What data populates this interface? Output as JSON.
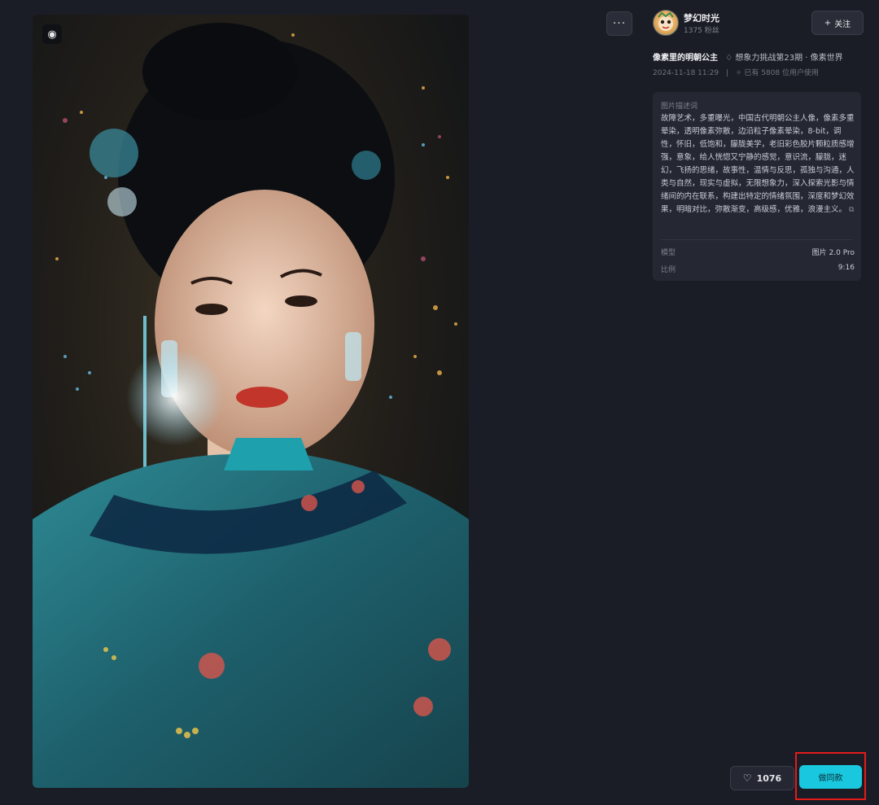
{
  "image": {
    "alt": "",
    "brand_badge_icon": "brain-icon"
  },
  "toolbar": {
    "more_label": "···"
  },
  "author": {
    "name": "梦幻时光",
    "fans": "1375 粉丝",
    "follow_label": "关注",
    "follow_icon": "+"
  },
  "work": {
    "title": "像素里的明朝公主",
    "challenge": "想象力挑战第23期 · 像素世界",
    "challenge_icon": "bulb-icon",
    "date": "2024-11-18 11:29",
    "usage": "已有 5808 位用户使用",
    "usage_icon": "wand-icon"
  },
  "prompt_card": {
    "label": "图片描述词",
    "text": "故障艺术，多重曝光，中国古代明朝公主人像，像素多重晕染，透明像素弥散，边沿粒子像素晕染，8-bit，调性，怀旧，低饱和，朦胧美学，老旧彩色胶片颗粒质感增强，意象，给人恍惚又宁静的感觉，意识流，朦胧，迷幻，飞扬的思绪，故事性，温情与反思，孤独与沟通，人类与自然，现实与虚拟，无限想象力，深入探索光影与情绪间的内在联系，构建出特定的情绪氛围，深度和梦幻效果，明暗对比，弥散渐变，高级感，优雅，浪漫主义。",
    "model_label": "模型",
    "model_value": "图片 2.0 Pro",
    "ratio_label": "比例",
    "ratio_value": "9:16"
  },
  "actions": {
    "like_count": "1076",
    "make_same_label": "做同款"
  },
  "colors": {
    "background": "#1b1d26",
    "card": "#252833",
    "accent": "#19c8df",
    "highlight": "#e21b1b"
  }
}
